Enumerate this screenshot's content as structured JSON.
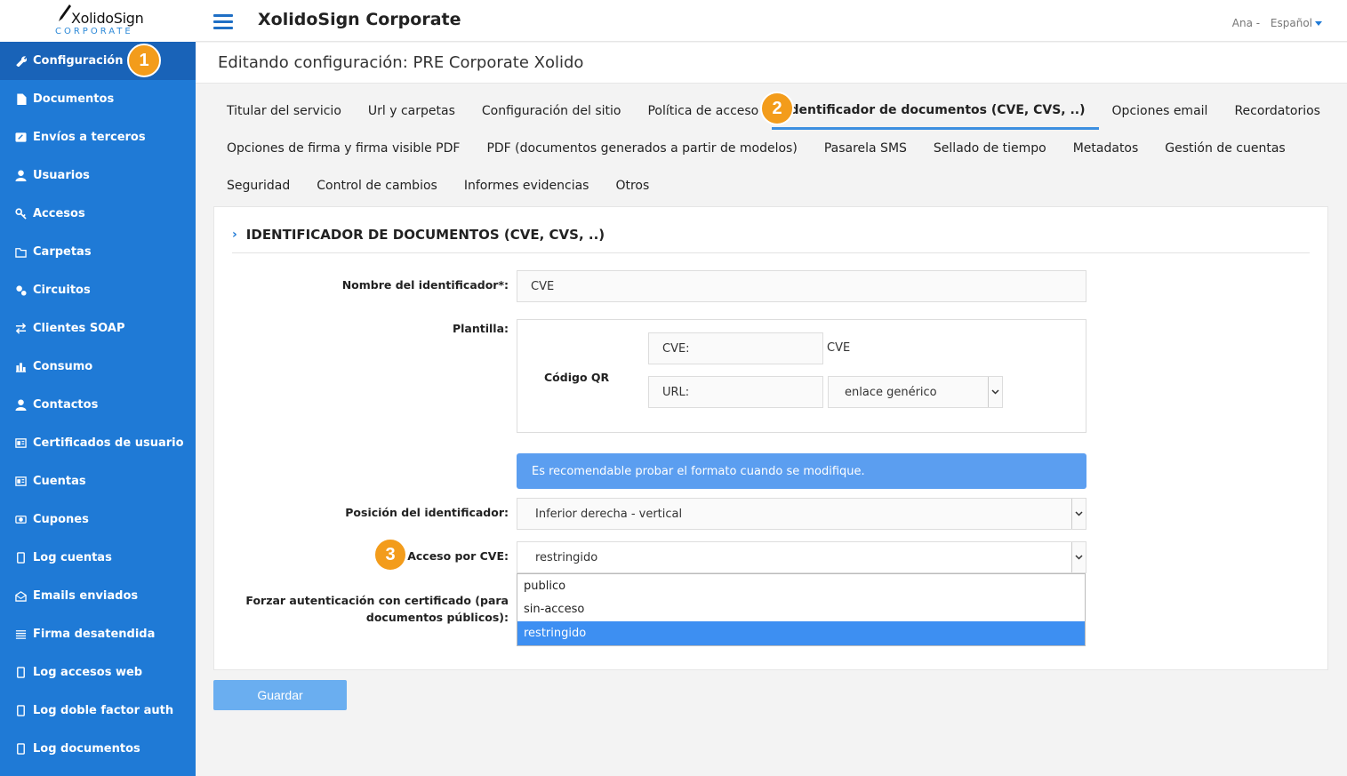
{
  "logo": {
    "name": "XolidoSign",
    "sub": "CORPORATE"
  },
  "header": {
    "app_title": "XolidoSign Corporate",
    "user": "Ana -",
    "language": "Español"
  },
  "page_title": "Editando configuración: PRE Corporate Xolido",
  "sidebar": {
    "items": [
      {
        "label": "Configuración",
        "icon": "wrench-icon"
      },
      {
        "label": "Documentos",
        "icon": "document-icon"
      },
      {
        "label": "Envíos a terceros",
        "icon": "send-icon"
      },
      {
        "label": "Usuarios",
        "icon": "user-icon"
      },
      {
        "label": "Accesos",
        "icon": "key-icon"
      },
      {
        "label": "Carpetas",
        "icon": "folder-icon"
      },
      {
        "label": "Circuitos",
        "icon": "cogs-icon"
      },
      {
        "label": "Clientes SOAP",
        "icon": "exchange-icon"
      },
      {
        "label": "Consumo",
        "icon": "bar-chart-icon"
      },
      {
        "label": "Contactos",
        "icon": "user-icon"
      },
      {
        "label": "Certificados de usuario",
        "icon": "id-card-icon"
      },
      {
        "label": "Cuentas",
        "icon": "id-card-icon"
      },
      {
        "label": "Cupones",
        "icon": "ticket-icon"
      },
      {
        "label": "Log cuentas",
        "icon": "book-icon"
      },
      {
        "label": "Emails enviados",
        "icon": "envelope-open-icon"
      },
      {
        "label": "Firma desatendida",
        "icon": "list-icon"
      },
      {
        "label": "Log accesos web",
        "icon": "book-icon"
      },
      {
        "label": "Log doble factor auth",
        "icon": "book-icon"
      },
      {
        "label": "Log documentos",
        "icon": "book-icon"
      }
    ]
  },
  "tabs": {
    "rows": [
      [
        "Titular del servicio",
        "Url y carpetas",
        "Configuración del sitio",
        "Política de acceso",
        "Identificador de documentos (CVE, CVS, ..)",
        "Opciones email",
        "Recordatorios"
      ],
      [
        "Opciones de firma y firma visible PDF",
        "PDF (documentos generados a partir de modelos)",
        "Pasarela SMS",
        "Sellado de tiempo",
        "Metadatos",
        "Gestión de cuentas"
      ],
      [
        "Seguridad",
        "Control de cambios",
        "Informes evidencias",
        "Otros"
      ]
    ]
  },
  "badges": {
    "one": "1",
    "two": "2",
    "three": "3"
  },
  "form": {
    "section_title": "IDENTIFICADOR DE DOCUMENTOS (CVE, CVS, ..)",
    "nombre_label": "Nombre del identificador*:",
    "nombre_value": "CVE",
    "plantilla_label": "Plantilla:",
    "qr_label": "Código QR",
    "cve_field": "CVE:",
    "cve_value": "CVE",
    "url_field": "URL:",
    "url_select": "enlace genérico",
    "alert": "Es recomendable probar el formato cuando se modifique.",
    "posicion_label": "Posición del identificador:",
    "posicion_value": "Inferior derecha - vertical",
    "acceso_label": "Acceso por CVE:",
    "acceso_value": "restringido",
    "forzar_label_1": "Forzar autenticación con certificado (para",
    "forzar_label_2": "documentos públicos):",
    "acceso_options": [
      "publico",
      "sin-acceso",
      "restringido"
    ]
  },
  "save_button": "Guardar",
  "colors": {
    "sidebar": "#1f7ad6",
    "badge": "#f39c1b",
    "alert": "#5b9ef0"
  }
}
